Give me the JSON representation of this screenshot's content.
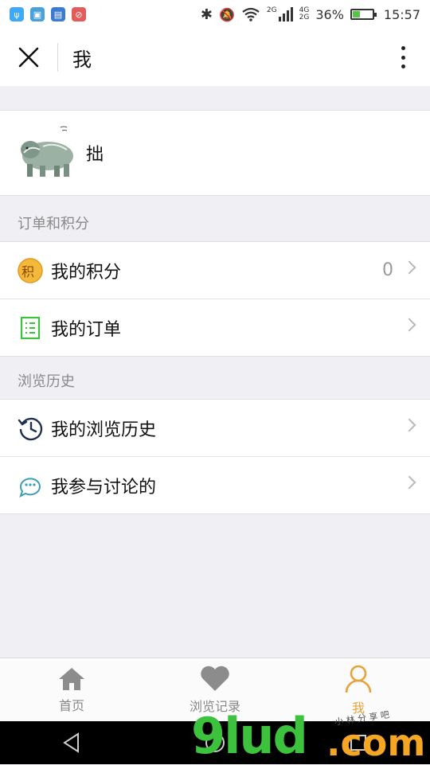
{
  "status_bar": {
    "network_top": "2G",
    "network_4g": "4G",
    "network_2g": "2G",
    "battery_percent": "36%",
    "battery_level": 0.36,
    "time": "15:57",
    "icons": [
      "usb-icon",
      "image-icon",
      "sim-icon",
      "blocked-icon",
      "bluetooth-icon",
      "mute-icon",
      "wifi-icon",
      "signal-icon",
      "battery-icon"
    ]
  },
  "header": {
    "title": "我"
  },
  "profile": {
    "name": "拙"
  },
  "sections": [
    {
      "title": "订单和积分",
      "items": [
        {
          "label": "我的积分",
          "value": "0",
          "icon": "points-icon",
          "icon_char": "积"
        },
        {
          "label": "我的订单",
          "value": "",
          "icon": "order-list-icon"
        }
      ]
    },
    {
      "title": "浏览历史",
      "items": [
        {
          "label": "我的浏览历史",
          "value": "",
          "icon": "history-clock-icon"
        },
        {
          "label": "我参与讨论的",
          "value": "",
          "icon": "discussion-icon"
        }
      ]
    }
  ],
  "tabs": [
    {
      "label": "首页",
      "icon": "home-icon"
    },
    {
      "label": "浏览记录",
      "icon": "heart-icon"
    },
    {
      "label": "我",
      "icon": "person-icon",
      "active": true
    }
  ],
  "watermark": {
    "main": "9lud",
    "suffix": ".com",
    "small": "小 林 分 享 吧"
  },
  "colors": {
    "accent": "#e7a23a",
    "order_icon": "#3cc23c",
    "history_icon": "#1f2f4f",
    "discussion_icon": "#3a9fb5"
  }
}
